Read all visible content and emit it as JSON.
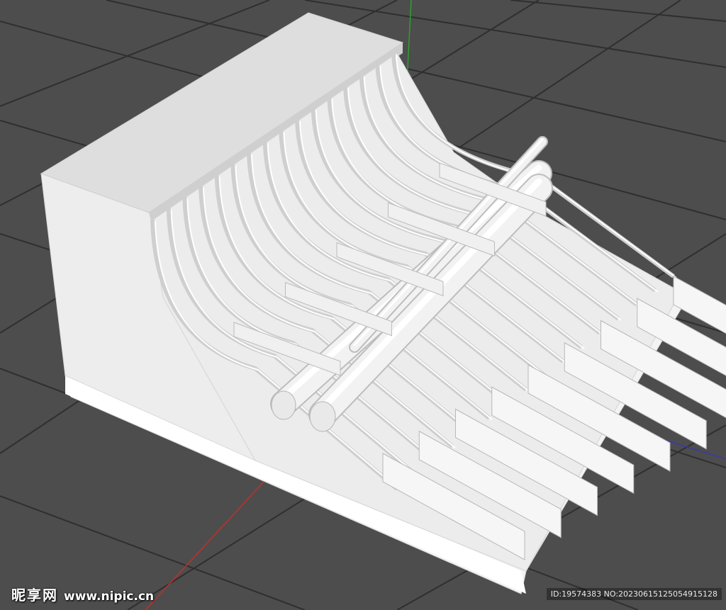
{
  "viewport": {
    "background": "#4d4d4d",
    "grid_color": "#2f2f2f",
    "axes": {
      "y_axis_color": "#2ca02c",
      "x_axis_color": "#c0302a",
      "z_axis_color": "#3a3aaa"
    }
  },
  "model": {
    "surface_color": "#ececec",
    "shade_color": "#cfcfcf",
    "dark_color": "#b8b8b8",
    "step_count": 16,
    "pipe_runs": 2,
    "supports": 5
  },
  "watermark": {
    "brand": "昵享网",
    "site": "www.nipic.cn",
    "id_text": "ID:19574383 NO:20230615125054915128"
  }
}
